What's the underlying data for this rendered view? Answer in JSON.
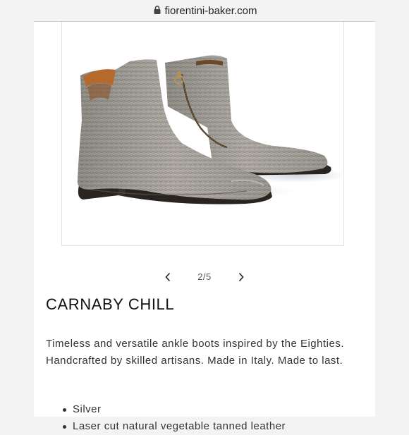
{
  "browser": {
    "url": "fiorentini-baker.com",
    "icon": "lock-icon"
  },
  "gallery": {
    "image_alt": "Silver snake-embossed leather ankle boots",
    "counter": "2/5",
    "prev_icon": "chevron-left-icon",
    "next_icon": "chevron-right-icon"
  },
  "product": {
    "title": "CARNABY CHILL",
    "description": "Timeless and versatile ankle boots inspired by the Eighties. Handcrafted by skilled artisans. Made in Italy. Made to last.",
    "features": [
      "Silver",
      "Laser cut natural vegetable tanned leather"
    ]
  },
  "colors": {
    "page_background": "#f3f3f3",
    "card_background": "#ffffff",
    "text": "#333333",
    "boot_leather": "#a9a59f",
    "boot_sole": "#2a2421"
  }
}
